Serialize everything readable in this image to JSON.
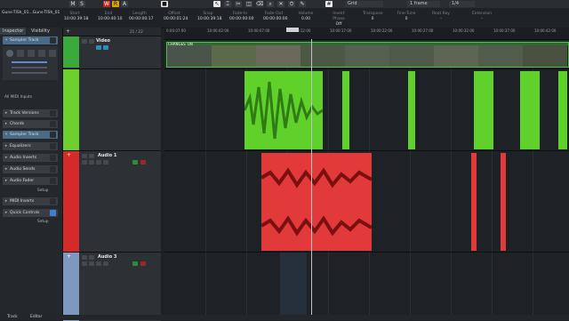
{
  "app": {
    "project_name": "Guns-TISh_01...Guns-TISh_01"
  },
  "transport": {
    "m": "M",
    "s": "S",
    "w": "W",
    "r": "R",
    "a": "A",
    "snap_mode": "Grid",
    "quantize": "1 frame",
    "zoom_fraction": "1/4"
  },
  "info": {
    "start": {
      "label": "Start",
      "value": "10:00:39:18"
    },
    "end": {
      "label": "End",
      "value": "10:00:40:10"
    },
    "length": {
      "label": "Length",
      "value": "00:00:00:17"
    },
    "offset": {
      "label": "Offset",
      "value": "00:00:01:24"
    },
    "snap": {
      "label": "Snap",
      "value": "10:00:39:18"
    },
    "fade_in": {
      "label": "Fade-In",
      "value": "00:00:00:00"
    },
    "fade_out": {
      "label": "Fade-Out",
      "value": "00:00:00:00"
    },
    "volume": {
      "label": "Volume",
      "value": "0.00"
    },
    "invert_phase": {
      "label": "Invert Phase",
      "value": "Off"
    },
    "transpose": {
      "label": "Transpose",
      "value": "0"
    },
    "fine_tune": {
      "label": "Fine-Tune",
      "value": "0"
    },
    "root_key": {
      "label": "Root Key",
      "value": "-"
    },
    "extension": {
      "label": "Extension",
      "value": "-"
    }
  },
  "inspector": {
    "tabs": [
      "Inspector",
      "Visibility"
    ],
    "track_header": "Sampler Track",
    "midi_inputs": "All MIDI Inputs",
    "sections": [
      "Track Versions",
      "Chords",
      "Sampler Track",
      "Equalizers",
      "Audio Inserts",
      "Audio Sends",
      "Audio Fader",
      "MIDI Inserts",
      "Quick Controls"
    ],
    "setup_label": "Setup"
  },
  "tracklist": {
    "counter": "21 / 22",
    "tracks": [
      {
        "name": "Video",
        "color": "#3aa83a"
      },
      {
        "name": "",
        "color": "#6ccf2e"
      },
      {
        "name": "Audio 1",
        "color": "#d42a2a"
      },
      {
        "name": "Audio 3",
        "color": "#7d99c0"
      }
    ]
  },
  "ruler": {
    "ticks": [
      "0:00:07:00",
      "10:00:02:00",
      "10:00:07:00",
      "10:00:12:00",
      "10:00:17:00",
      "10:00:22:00",
      "10:00:27:00",
      "10:00:32:00",
      "10:00:37:00",
      "10:00:42:00"
    ]
  },
  "video_clip": {
    "label": "CHANGES_ON"
  },
  "bottom": {
    "tab1": "Track",
    "tab2": "Editor"
  },
  "colors": {
    "green_clip": "#5fd12a",
    "red_clip": "#e23a3a",
    "accent": "#3f7fcf"
  }
}
